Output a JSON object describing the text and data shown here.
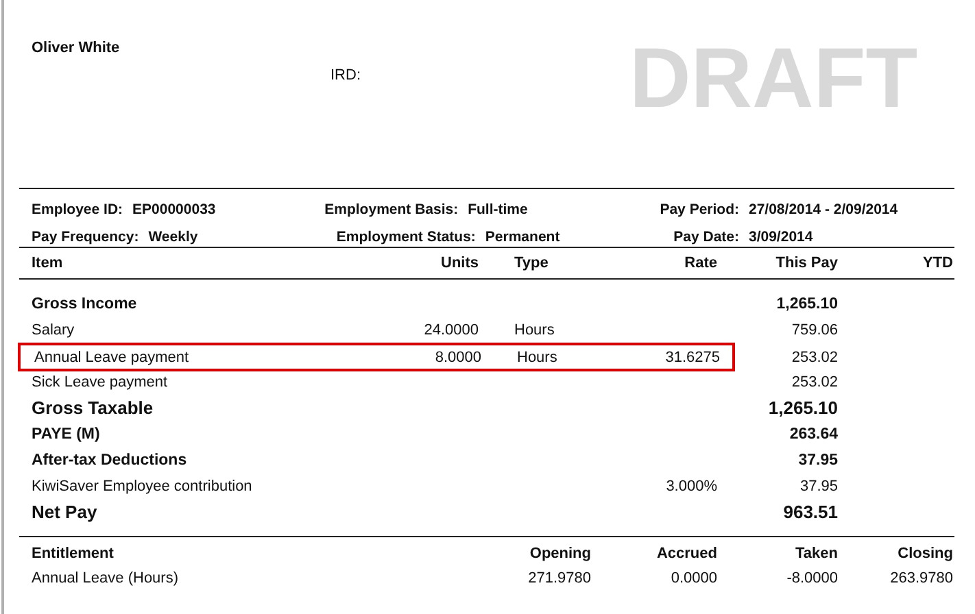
{
  "header": {
    "employee_name": "Oliver White",
    "ird_label": "IRD:",
    "watermark": "DRAFT"
  },
  "info": [
    [
      {
        "label": "Employee ID:",
        "value": "EP00000033"
      },
      {
        "label": "Employment Basis:",
        "value": "Full-time"
      },
      {
        "label": "Pay Period:",
        "value": "27/08/2014 - 2/09/2014"
      }
    ],
    [
      {
        "label": "Pay Frequency:",
        "value": "Weekly"
      },
      {
        "label": "Employment Status:",
        "value": "Permanent"
      },
      {
        "label": "Pay Date:",
        "value": "3/09/2014"
      }
    ]
  ],
  "pay_table": {
    "columns": [
      "Item",
      "Units",
      "Type",
      "Rate",
      "This Pay",
      "YTD"
    ],
    "rows": [
      {
        "kind": "heading",
        "item": "Gross Income",
        "this_pay": "1,265.10",
        "highlighted": false
      },
      {
        "kind": "line",
        "item": "Salary",
        "units": "24.0000",
        "type": "Hours",
        "this_pay": "759.06",
        "highlighted": false
      },
      {
        "kind": "line",
        "item": "Annual Leave payment",
        "units": "8.0000",
        "type": "Hours",
        "rate": "31.6275",
        "this_pay": "253.02",
        "highlighted": true
      },
      {
        "kind": "line",
        "item": "Sick Leave payment",
        "this_pay": "253.02",
        "highlighted": false
      },
      {
        "kind": "total",
        "item": "Gross Taxable",
        "this_pay": "1,265.10",
        "highlighted": false
      },
      {
        "kind": "heading",
        "item": "PAYE (M)",
        "this_pay": "263.64",
        "highlighted": false
      },
      {
        "kind": "heading",
        "item": "After-tax Deductions",
        "this_pay": "37.95",
        "highlighted": false
      },
      {
        "kind": "line",
        "item": "KiwiSaver Employee contribution",
        "rate": "3.000%",
        "this_pay": "37.95",
        "highlighted": false
      },
      {
        "kind": "total",
        "item": "Net Pay",
        "this_pay": "963.51",
        "highlighted": false
      }
    ]
  },
  "entitlements": {
    "columns": [
      "Entitlement",
      "Opening",
      "Accrued",
      "Taken",
      "Closing"
    ],
    "rows": [
      {
        "item": "Annual Leave (Hours)",
        "opening": "271.9780",
        "accrued": "0.0000",
        "taken": "-8.0000",
        "closing": "263.9780"
      }
    ]
  }
}
